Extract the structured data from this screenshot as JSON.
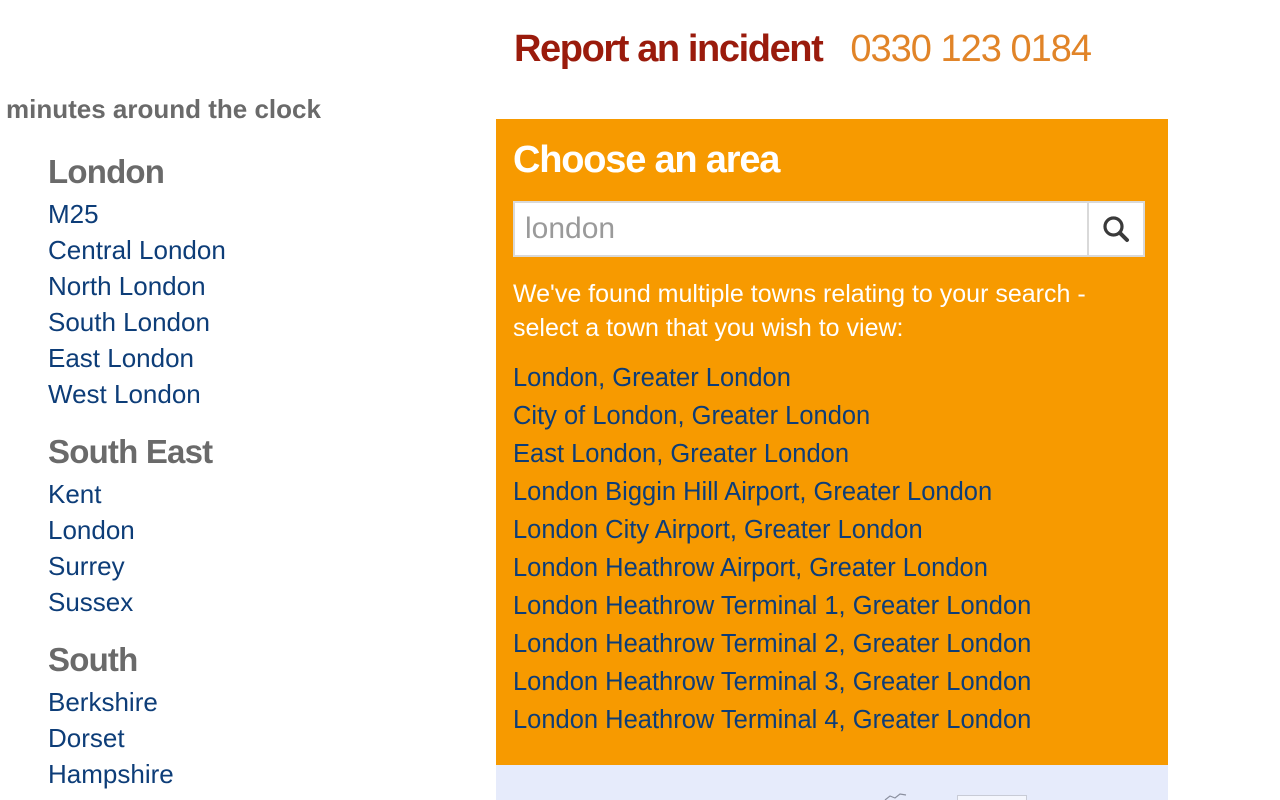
{
  "header": {
    "incident_label": "Report an incident",
    "incident_phone": "0330 123 0184"
  },
  "tagline": "minutes around the clock",
  "regions": [
    {
      "title": "London",
      "links": [
        "M25",
        "Central London",
        "North London",
        "South London",
        "East London",
        "West London"
      ]
    },
    {
      "title": "South East",
      "links": [
        "Kent",
        "London",
        "Surrey",
        "Sussex"
      ]
    },
    {
      "title": "South",
      "links": [
        "Berkshire",
        "Dorset",
        "Hampshire"
      ]
    }
  ],
  "area_panel": {
    "title": "Choose an area",
    "search": {
      "placeholder": "london",
      "icon": "search-icon"
    },
    "message": "We've found multiple towns relating to your search - select a town that you wish to view:",
    "results": [
      "London, Greater London",
      "City of London, Greater London",
      "East London, Greater London",
      "London Biggin Hill Airport, Greater London",
      "London City Airport, Greater London",
      "London Heathrow Airport, Greater London",
      "London Heathrow Terminal 1, Greater London",
      "London Heathrow Terminal 2, Greater London",
      "London Heathrow Terminal 3, Greater London",
      "London Heathrow Terminal 4, Greater London"
    ]
  },
  "colors": {
    "panel_bg": "#f79a00",
    "link": "#0d3d78",
    "incident_label": "#9a1b0c",
    "incident_phone": "#e18428",
    "heading_grey": "#6a6a6a"
  }
}
